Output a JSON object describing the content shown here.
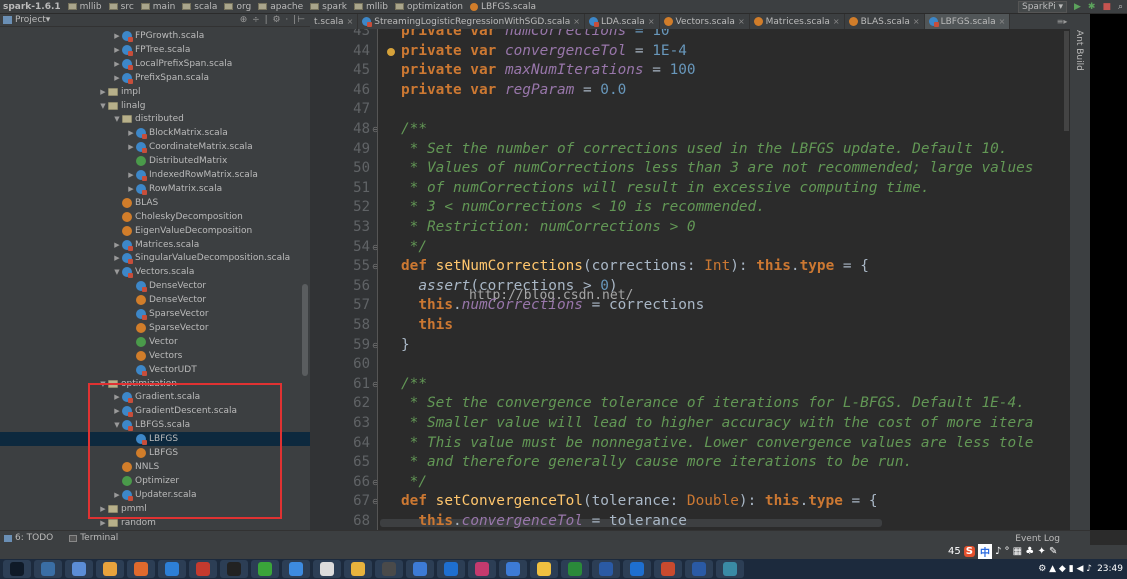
{
  "navbar": {
    "crumbs": [
      "spark-1.6.1",
      "mllib",
      "src",
      "main",
      "scala",
      "org",
      "apache",
      "spark",
      "mllib",
      "optimization",
      "LBFGS.scala"
    ],
    "run_config": "SparkPi"
  },
  "project": {
    "title": "Project",
    "tree": [
      {
        "label": "FPGrowth.scala",
        "icon": "scala",
        "indent": 8,
        "arrow": "right"
      },
      {
        "label": "FPTree.scala",
        "icon": "scala",
        "indent": 8,
        "arrow": "right"
      },
      {
        "label": "LocalPrefixSpan.scala",
        "icon": "scala",
        "indent": 8,
        "arrow": "right"
      },
      {
        "label": "PrefixSpan.scala",
        "icon": "scala",
        "indent": 8,
        "arrow": "right"
      },
      {
        "label": "impl",
        "icon": "folder",
        "indent": 7,
        "arrow": "right"
      },
      {
        "label": "linalg",
        "icon": "folder",
        "indent": 7,
        "arrow": "down"
      },
      {
        "label": "distributed",
        "icon": "folder",
        "indent": 8,
        "arrow": "down"
      },
      {
        "label": "BlockMatrix.scala",
        "icon": "scala",
        "indent": 9,
        "arrow": "right"
      },
      {
        "label": "CoordinateMatrix.scala",
        "icon": "scala",
        "indent": 9,
        "arrow": "right"
      },
      {
        "label": "DistributedMatrix",
        "icon": "trait",
        "indent": 9,
        "arrow": ""
      },
      {
        "label": "IndexedRowMatrix.scala",
        "icon": "scala",
        "indent": 9,
        "arrow": "right"
      },
      {
        "label": "RowMatrix.scala",
        "icon": "scala",
        "indent": 9,
        "arrow": "right"
      },
      {
        "label": "BLAS",
        "icon": "cls",
        "indent": 8,
        "arrow": ""
      },
      {
        "label": "CholeskyDecomposition",
        "icon": "cls",
        "indent": 8,
        "arrow": ""
      },
      {
        "label": "EigenValueDecomposition",
        "icon": "cls",
        "indent": 8,
        "arrow": ""
      },
      {
        "label": "Matrices.scala",
        "icon": "scala",
        "indent": 8,
        "arrow": "right"
      },
      {
        "label": "SingularValueDecomposition.scala",
        "icon": "scala",
        "indent": 8,
        "arrow": "right"
      },
      {
        "label": "Vectors.scala",
        "icon": "scala",
        "indent": 8,
        "arrow": "down"
      },
      {
        "label": "DenseVector",
        "icon": "scala",
        "indent": 9,
        "arrow": ""
      },
      {
        "label": "DenseVector",
        "icon": "cls",
        "indent": 9,
        "arrow": ""
      },
      {
        "label": "SparseVector",
        "icon": "scala",
        "indent": 9,
        "arrow": ""
      },
      {
        "label": "SparseVector",
        "icon": "cls",
        "indent": 9,
        "arrow": ""
      },
      {
        "label": "Vector",
        "icon": "trait",
        "indent": 9,
        "arrow": ""
      },
      {
        "label": "Vectors",
        "icon": "cls",
        "indent": 9,
        "arrow": ""
      },
      {
        "label": "VectorUDT",
        "icon": "scala",
        "indent": 9,
        "arrow": ""
      },
      {
        "label": "optimization",
        "icon": "folder",
        "indent": 7,
        "arrow": "down"
      },
      {
        "label": "Gradient.scala",
        "icon": "scala",
        "indent": 8,
        "arrow": "right"
      },
      {
        "label": "GradientDescent.scala",
        "icon": "scala",
        "indent": 8,
        "arrow": "right"
      },
      {
        "label": "LBFGS.scala",
        "icon": "scala",
        "indent": 8,
        "arrow": "down"
      },
      {
        "label": "LBFGS",
        "icon": "scala",
        "indent": 9,
        "arrow": "",
        "selected": true
      },
      {
        "label": "LBFGS",
        "icon": "cls",
        "indent": 9,
        "arrow": ""
      },
      {
        "label": "NNLS",
        "icon": "cls",
        "indent": 8,
        "arrow": ""
      },
      {
        "label": "Optimizer",
        "icon": "trait",
        "indent": 8,
        "arrow": ""
      },
      {
        "label": "Updater.scala",
        "icon": "scala",
        "indent": 8,
        "arrow": "right"
      },
      {
        "label": "pmml",
        "icon": "folder",
        "indent": 7,
        "arrow": "right"
      },
      {
        "label": "random",
        "icon": "folder",
        "indent": 7,
        "arrow": "right"
      }
    ]
  },
  "tabs": [
    {
      "label": "t.scala",
      "icon": "",
      "active": false
    },
    {
      "label": "StreamingLogisticRegressionWithSGD.scala",
      "icon": "scala",
      "active": false
    },
    {
      "label": "LDA.scala",
      "icon": "scala",
      "active": false
    },
    {
      "label": "Vectors.scala",
      "icon": "cls",
      "active": false
    },
    {
      "label": "Matrices.scala",
      "icon": "cls",
      "active": false
    },
    {
      "label": "BLAS.scala",
      "icon": "cls",
      "active": false
    },
    {
      "label": "LBFGS.scala",
      "icon": "scala",
      "active": true
    }
  ],
  "editor": {
    "lines": [
      {
        "n": "43",
        "fold": "",
        "bp": false,
        "tokens": [
          {
            "t": "private var ",
            "c": "kw"
          },
          {
            "t": "numCorrections",
            "c": "fld"
          },
          {
            "t": " = 10",
            "c": "num"
          }
        ]
      },
      {
        "n": "44",
        "fold": "",
        "bp": true,
        "tokens": [
          {
            "t": "private var ",
            "c": "kw"
          },
          {
            "t": "convergenceTol",
            "c": "fld"
          },
          {
            "t": " = ",
            "c": ""
          },
          {
            "t": "1E-4",
            "c": "num"
          }
        ]
      },
      {
        "n": "45",
        "fold": "",
        "bp": false,
        "tokens": [
          {
            "t": "private var ",
            "c": "kw"
          },
          {
            "t": "maxNumIterations",
            "c": "fld"
          },
          {
            "t": " = ",
            "c": ""
          },
          {
            "t": "100",
            "c": "num"
          }
        ]
      },
      {
        "n": "46",
        "fold": "",
        "bp": false,
        "tokens": [
          {
            "t": "private var ",
            "c": "kw"
          },
          {
            "t": "regParam",
            "c": "fld"
          },
          {
            "t": " = ",
            "c": ""
          },
          {
            "t": "0.0",
            "c": "num"
          }
        ]
      },
      {
        "n": "47",
        "fold": "",
        "bp": false,
        "tokens": []
      },
      {
        "n": "48",
        "fold": "⊖",
        "bp": false,
        "tokens": [
          {
            "t": "/**",
            "c": "cmt"
          }
        ]
      },
      {
        "n": "49",
        "fold": "",
        "bp": false,
        "tokens": [
          {
            "t": " * Set the number of corrections used in the LBFGS update. Default 10.",
            "c": "cmt"
          }
        ]
      },
      {
        "n": "50",
        "fold": "",
        "bp": false,
        "tokens": [
          {
            "t": " * Values of numCorrections less than 3 are not recommended; large values",
            "c": "cmt"
          }
        ]
      },
      {
        "n": "51",
        "fold": "",
        "bp": false,
        "tokens": [
          {
            "t": " * of numCorrections will result in excessive computing time.",
            "c": "cmt"
          }
        ]
      },
      {
        "n": "52",
        "fold": "",
        "bp": false,
        "tokens": [
          {
            "t": " * 3 < numCorrections < 10 is recommended.",
            "c": "cmt"
          }
        ]
      },
      {
        "n": "53",
        "fold": "",
        "bp": false,
        "tokens": [
          {
            "t": " * Restriction: numCorrections > 0",
            "c": "cmt"
          }
        ]
      },
      {
        "n": "54",
        "fold": "⊖",
        "bp": false,
        "tokens": [
          {
            "t": " */",
            "c": "cmt"
          }
        ]
      },
      {
        "n": "55",
        "fold": "⊖",
        "bp": false,
        "tokens": [
          {
            "t": "def ",
            "c": "kw"
          },
          {
            "t": "setNumCorrections",
            "c": "fn"
          },
          {
            "t": "(corrections: ",
            "c": ""
          },
          {
            "t": "Int",
            "c": "ty"
          },
          {
            "t": "): ",
            "c": ""
          },
          {
            "t": "this",
            "c": "kw"
          },
          {
            "t": ".",
            "c": ""
          },
          {
            "t": "type",
            "c": "kw"
          },
          {
            "t": " = {",
            "c": ""
          }
        ]
      },
      {
        "n": "56",
        "fold": "",
        "bp": false,
        "tokens": [
          {
            "t": "  ",
            "c": ""
          },
          {
            "t": "assert",
            "c": "it"
          },
          {
            "t": "(corrections > ",
            "c": ""
          },
          {
            "t": "0",
            "c": "num"
          },
          {
            "t": ")",
            "c": ""
          }
        ]
      },
      {
        "n": "57",
        "fold": "",
        "bp": false,
        "tokens": [
          {
            "t": "  ",
            "c": ""
          },
          {
            "t": "this",
            "c": "kw"
          },
          {
            "t": ".",
            "c": ""
          },
          {
            "t": "numCorrections",
            "c": "fld"
          },
          {
            "t": " = corrections",
            "c": ""
          }
        ]
      },
      {
        "n": "58",
        "fold": "",
        "bp": false,
        "tokens": [
          {
            "t": "  ",
            "c": ""
          },
          {
            "t": "this",
            "c": "kw"
          }
        ]
      },
      {
        "n": "59",
        "fold": "⊖",
        "bp": false,
        "tokens": [
          {
            "t": "}",
            "c": ""
          }
        ]
      },
      {
        "n": "60",
        "fold": "",
        "bp": false,
        "tokens": []
      },
      {
        "n": "61",
        "fold": "⊖",
        "bp": false,
        "tokens": [
          {
            "t": "/**",
            "c": "cmt"
          }
        ]
      },
      {
        "n": "62",
        "fold": "",
        "bp": false,
        "tokens": [
          {
            "t": " * Set the convergence tolerance of iterations for L-BFGS. Default 1E-4.",
            "c": "cmt"
          }
        ]
      },
      {
        "n": "63",
        "fold": "",
        "bp": false,
        "tokens": [
          {
            "t": " * Smaller value will lead to higher accuracy with the cost of more itera",
            "c": "cmt"
          }
        ]
      },
      {
        "n": "64",
        "fold": "",
        "bp": false,
        "tokens": [
          {
            "t": " * This value must be nonnegative. Lower convergence values are less tole",
            "c": "cmt"
          }
        ]
      },
      {
        "n": "65",
        "fold": "",
        "bp": false,
        "tokens": [
          {
            "t": " * and therefore generally cause more iterations to be run.",
            "c": "cmt"
          }
        ]
      },
      {
        "n": "66",
        "fold": "⊖",
        "bp": false,
        "tokens": [
          {
            "t": " */",
            "c": "cmt"
          }
        ]
      },
      {
        "n": "67",
        "fold": "⊖",
        "bp": false,
        "tokens": [
          {
            "t": "def ",
            "c": "kw"
          },
          {
            "t": "setConvergenceTol",
            "c": "fn"
          },
          {
            "t": "(tolerance: ",
            "c": ""
          },
          {
            "t": "Double",
            "c": "ty"
          },
          {
            "t": "): ",
            "c": ""
          },
          {
            "t": "this",
            "c": "kw"
          },
          {
            "t": ".",
            "c": ""
          },
          {
            "t": "type",
            "c": "kw"
          },
          {
            "t": " = {",
            "c": ""
          }
        ]
      },
      {
        "n": "68",
        "fold": "",
        "bp": false,
        "tokens": [
          {
            "t": "  ",
            "c": ""
          },
          {
            "t": "this",
            "c": "kw"
          },
          {
            "t": ".",
            "c": ""
          },
          {
            "t": "convergenceTol",
            "c": "fld"
          },
          {
            "t": " = tolerance",
            "c": ""
          }
        ]
      }
    ],
    "watermark": "http://blog.csdn.net/"
  },
  "right_stripe": {
    "ant_build": "Ant Build"
  },
  "bottom_bar": {
    "todo": "6: TODO",
    "terminal": "Terminal",
    "event_log": "Event Log"
  },
  "ime": {
    "lang": "中",
    "number": "45"
  },
  "taskbar": {
    "apps": [
      "#3a6ea5",
      "#5b8dd6",
      "#e8a33d",
      "#e06a2d",
      "#2d7fd6",
      "#c43a2e",
      "#222222",
      "#3aa53a",
      "#3d8be0",
      "#dcdcdc",
      "#e8b33d",
      "#4a4a4a",
      "#3d7bd6",
      "#1e6fd0",
      "#c43a6e",
      "#3d7bd6",
      "#f0c040",
      "#2a8a3a",
      "#2a5aa5",
      "#1e6fd0",
      "#c84a2e",
      "#2a5aa5",
      "#3a8aa5"
    ],
    "time": "23:49"
  }
}
